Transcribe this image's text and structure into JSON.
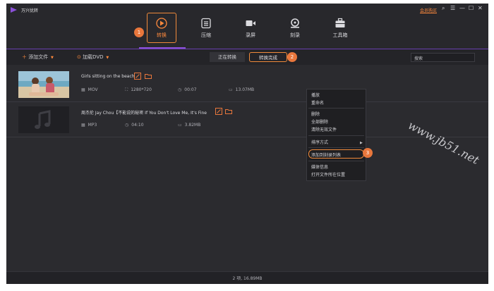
{
  "app": {
    "title": "万兴优转",
    "buy_link": "会员购买"
  },
  "window_controls": [
    "⌕",
    "☰",
    "—",
    "☐",
    "✕"
  ],
  "nav": {
    "tabs": [
      {
        "label": "转换",
        "icon": "convert-icon",
        "active": true
      },
      {
        "label": "压缩",
        "icon": "compress-icon",
        "active": false
      },
      {
        "label": "录屏",
        "icon": "record-icon",
        "active": false
      },
      {
        "label": "刻录",
        "icon": "burn-icon",
        "active": false
      },
      {
        "label": "工具箱",
        "icon": "toolbox-icon",
        "active": false
      }
    ]
  },
  "callouts": [
    "1",
    "2",
    "3"
  ],
  "toolbar": {
    "add_file": "添加文件",
    "load_dvd": "加载DVD",
    "status_tabs": [
      "正在转换",
      "转换完成"
    ],
    "search_placeholder": "搜索"
  },
  "files": [
    {
      "name": "Girls sitting on the beach",
      "format": "MOV",
      "resolution": "1280*720",
      "duration": "00:07",
      "size": "13.07MB",
      "thumb": "beach-photo"
    },
    {
      "name": "周杰伦 Jay Chou【不能说的秘密 If You Don't Love Me, It's Fine",
      "format": "MP3",
      "duration": "04:10",
      "size": "3.82MB",
      "thumb": "music-note-icon"
    }
  ],
  "context_menu": {
    "items": [
      "播放",
      "重命名",
      "删除",
      "全部删除",
      "清除无效文件",
      "排序方式",
      "添加到刻录列表",
      "媒体信息",
      "打开文件所在位置"
    ]
  },
  "footer": {
    "summary": "2 项, 16.89MB"
  },
  "watermark": "www.jb51.net",
  "colors": {
    "accent": "#f08a3a",
    "purple": "#8a50d8",
    "background": "#2b2b2f"
  }
}
